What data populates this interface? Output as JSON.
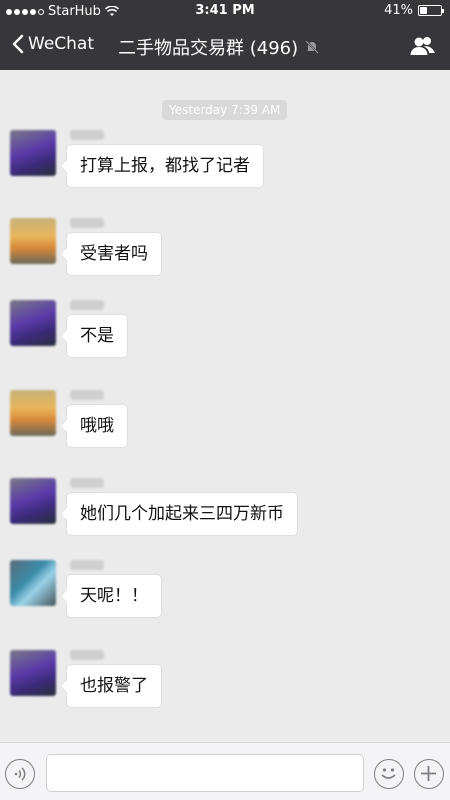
{
  "status_bar": {
    "carrier": "StarHub",
    "time": "3:41 PM",
    "battery_text": "41%",
    "battery_level": 0.41
  },
  "header": {
    "back_label": "WeChat",
    "title": "二手物品交易群 (496)"
  },
  "timestamp": "Yesterday 7:39 AM",
  "messages": [
    {
      "text": "打算上报，都找了记者",
      "avatar": "purple"
    },
    {
      "text": "受害者吗",
      "avatar": "sunset"
    },
    {
      "text": "不是",
      "avatar": "purple"
    },
    {
      "text": "哦哦",
      "avatar": "sunset"
    },
    {
      "text": "她们几个加起来三四万新币",
      "avatar": "purple"
    },
    {
      "text": "天呢！！",
      "avatar": "blue"
    },
    {
      "text": "也报警了",
      "avatar": "purple"
    }
  ],
  "colors": {
    "nav_bg": "#37373b",
    "chat_bg": "#ebebeb",
    "bubble_bg": "#ffffff"
  }
}
